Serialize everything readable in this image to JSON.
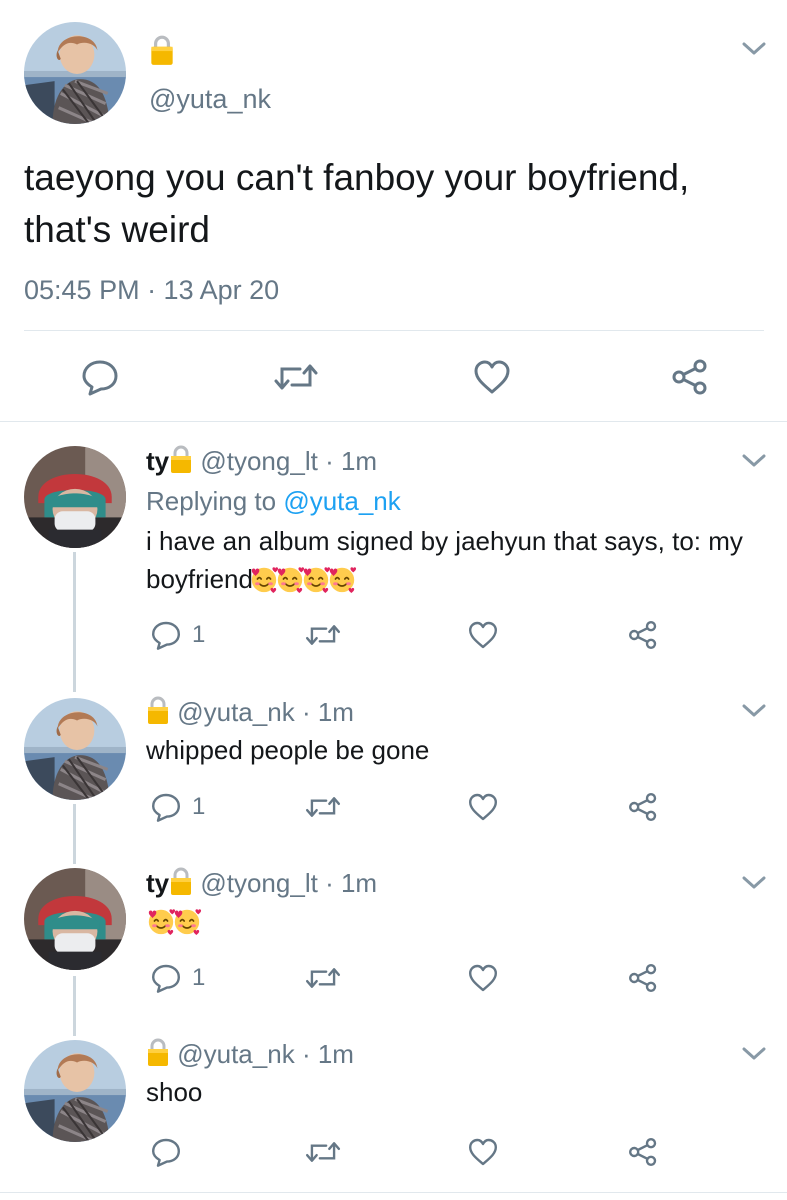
{
  "main_tweet": {
    "handle": "@yuta_nk",
    "text": "taeyong you can't fanboy your boyfriend, that's weird",
    "timestamp": "05:45 PM · 13 Apr 20",
    "actions": [
      "reply-icon",
      "retweet-icon",
      "like-icon",
      "share-icon"
    ]
  },
  "replies": [
    {
      "display_name": "ty",
      "handle": "@tyong_lt",
      "sep": "·",
      "time": "1m",
      "replying_prefix": "Replying to ",
      "replying_to": "@yuta_nk",
      "text": "i have an album signed by jaehyun that says, to: my boyfriend",
      "emoji_count": 4,
      "reply_count": "1"
    },
    {
      "display_name": "",
      "handle": "@yuta_nk",
      "sep": "·",
      "time": "1m",
      "text": "whipped people be gone",
      "reply_count": "1"
    },
    {
      "display_name": "ty",
      "handle": "@tyong_lt",
      "sep": "·",
      "time": "1m",
      "text": "",
      "emoji_count": 2,
      "reply_count": "1"
    },
    {
      "display_name": "",
      "handle": "@yuta_nk",
      "sep": "·",
      "time": "1m",
      "text": "shoo",
      "reply_count": ""
    }
  ],
  "colors": {
    "text": "#14171a",
    "muted": "#657786",
    "link": "#1da1f2",
    "divider": "#e1e8ed",
    "thread_line": "#ccd6dd",
    "lock": "#f5b800"
  }
}
